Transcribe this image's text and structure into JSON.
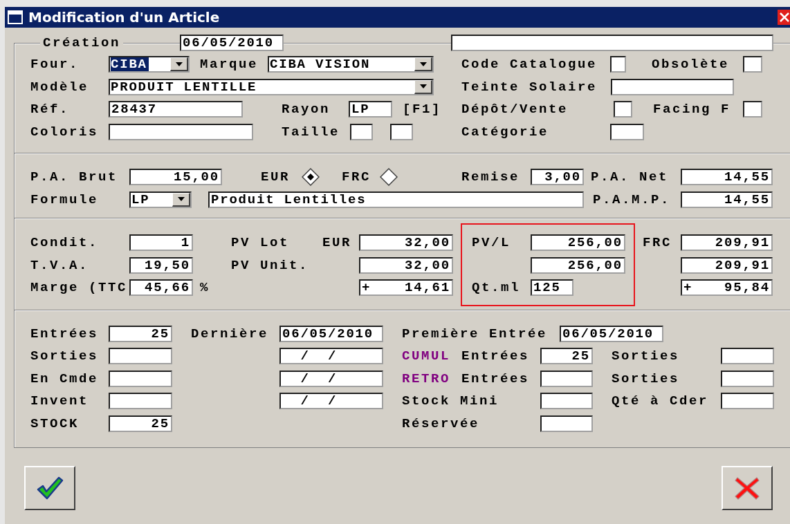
{
  "window": {
    "title": "Modification d'un Article"
  },
  "header": {
    "label": "Création",
    "date": "06/05/2010"
  },
  "sections": [
    {
      "rows": [
        [
          {
            "kind": "label",
            "text": "Four."
          },
          {
            "kind": "combo",
            "value": "CIBA",
            "highlighted": true
          },
          {
            "kind": "label",
            "text": "Marque"
          },
          {
            "kind": "combo",
            "value": "CIBA VISION",
            "highlighted": false
          },
          "",
          "",
          {
            "kind": "label",
            "text": "Code Catalogue"
          },
          {
            "kind": "field"
          },
          {
            "kind": "label",
            "text": "Obsolète"
          },
          {
            "kind": "field"
          }
        ],
        [
          {
            "kind": "label",
            "text": "Modèle"
          },
          {
            "kind": "combo",
            "value": "PRODUIT LENTILLE",
            "highlighted": false
          },
          "",
          "",
          "",
          "",
          {
            "kind": "label",
            "text": "Teinte Solaire"
          },
          {
            "kind": "field"
          }
        ],
        [
          {
            "kind": "label",
            "text": "Réf."
          },
          {
            "kind": "field",
            "value": "28437"
          },
          "",
          {
            "kind": "label",
            "text": "Rayon"
          },
          {
            "kind": "field",
            "value": "LP"
          },
          {
            "kind": "label",
            "text": "[F1]"
          },
          {
            "kind": "label",
            "text": "Dépôt/Vente"
          },
          {
            "kind": "field"
          },
          {
            "kind": "label",
            "text": "Facing F"
          },
          {
            "kind": "field"
          }
        ],
        [
          {
            "kind": "label",
            "text": "Coloris"
          },
          {
            "kind": "field"
          },
          "",
          {
            "kind": "label",
            "text": "Taille"
          },
          {
            "kind": "field"
          },
          {
            "kind": "field"
          },
          {
            "kind": "label",
            "text": "Catégorie"
          },
          {
            "kind": "field"
          }
        ]
      ]
    },
    {
      "rows": [
        [
          {
            "kind": "label",
            "text": "P.A. Brut"
          },
          {
            "kind": "field",
            "value": "15,00"
          },
          {
            "kind": "label",
            "text": "EUR"
          },
          {
            "kind": "radio",
            "selected": true
          },
          {
            "kind": "label",
            "text": "FRC"
          },
          {
            "kind": "radio",
            "selected": false
          },
          {
            "kind": "label",
            "text": "Remise"
          },
          {
            "kind": "field",
            "value": "3,00"
          },
          {
            "kind": "label",
            "text": "P.A. Net"
          },
          {
            "kind": "field",
            "value": "14,55"
          }
        ],
        [
          {
            "kind": "label",
            "text": "Formule"
          },
          {
            "kind": "combo",
            "value": "LP",
            "highlighted": false
          },
          {
            "kind": "field",
            "value": "Produit Lentilles"
          },
          "",
          "",
          "",
          "",
          "",
          {
            "kind": "label",
            "text": "P.A.M.P."
          },
          {
            "kind": "field",
            "value": "14,55"
          }
        ]
      ]
    },
    {
      "rows": [
        [
          {
            "kind": "label",
            "text": "Condit."
          },
          {
            "kind": "field",
            "value": "1"
          },
          {
            "kind": "label",
            "text": "PV Lot"
          },
          {
            "kind": "label",
            "text": "EUR"
          },
          {
            "kind": "field",
            "value": "32,00"
          },
          {
            "kind": "label",
            "text": "PV/L"
          },
          {
            "kind": "field",
            "value": "256,00"
          },
          {
            "kind": "label",
            "text": "FRC"
          },
          {
            "kind": "field",
            "value": "209,91"
          }
        ],
        [
          {
            "kind": "label",
            "text": "T.V.A."
          },
          {
            "kind": "field",
            "value": "19,50"
          },
          {
            "kind": "label",
            "text": "PV Unit."
          },
          "",
          {
            "kind": "field",
            "value": "32,00"
          },
          "",
          {
            "kind": "field",
            "value": "256,00"
          },
          "",
          {
            "kind": "field",
            "value": "209,91"
          }
        ],
        [
          {
            "kind": "label",
            "text": "Marge (TTC"
          },
          {
            "kind": "field",
            "value": "45,66"
          },
          {
            "kind": "label",
            "text": "%"
          },
          "",
          {
            "kind": "field",
            "sign": "+",
            "value": "14,61"
          },
          {
            "kind": "label",
            "text": "Qt.ml"
          },
          {
            "kind": "field",
            "value": "125"
          },
          "",
          {
            "kind": "field",
            "sign": "+",
            "value": "95,84"
          }
        ]
      ]
    },
    {
      "rows": [
        [
          {
            "kind": "label",
            "text": "Entrées"
          },
          {
            "kind": "field",
            "value": "25"
          },
          {
            "kind": "label",
            "text": "Dernière"
          },
          {
            "kind": "field",
            "value": "06/05/2010"
          },
          {
            "kind": "label",
            "text": "Première Entrée"
          },
          "",
          {
            "kind": "field",
            "value": "06/05/2010"
          }
        ],
        [
          {
            "kind": "label",
            "text": "Sorties"
          },
          {
            "kind": "field"
          },
          "",
          {
            "kind": "field",
            "value": "  /  /"
          },
          {
            "kind": "label",
            "text": "CUMUL",
            "color": "#800080"
          },
          {
            "kind": "label",
            "text": "Entrées"
          },
          {
            "kind": "field",
            "value": "25"
          },
          {
            "kind": "label",
            "text": "Sorties"
          },
          {
            "kind": "field"
          }
        ],
        [
          {
            "kind": "label",
            "text": "En Cmde"
          },
          {
            "kind": "field"
          },
          "",
          {
            "kind": "field",
            "value": "  /  /"
          },
          {
            "kind": "label",
            "text": "RETRO",
            "color": "#800080"
          },
          {
            "kind": "label",
            "text": "Entrées"
          },
          {
            "kind": "field"
          },
          {
            "kind": "label",
            "text": "Sorties"
          },
          {
            "kind": "field"
          }
        ],
        [
          {
            "kind": "label",
            "text": "Invent"
          },
          {
            "kind": "field"
          },
          "",
          {
            "kind": "field",
            "value": "  /  /"
          },
          {
            "kind": "label",
            "text": "Stock Mini"
          },
          "",
          {
            "kind": "field"
          },
          {
            "kind": "label",
            "text": "Qté à Cder"
          },
          {
            "kind": "field"
          }
        ],
        [
          {
            "kind": "label",
            "text": "STOCK"
          },
          {
            "kind": "field",
            "value": "25"
          },
          "",
          "",
          {
            "kind": "label",
            "text": "Réservée"
          },
          "",
          {
            "kind": "field"
          }
        ]
      ]
    }
  ]
}
